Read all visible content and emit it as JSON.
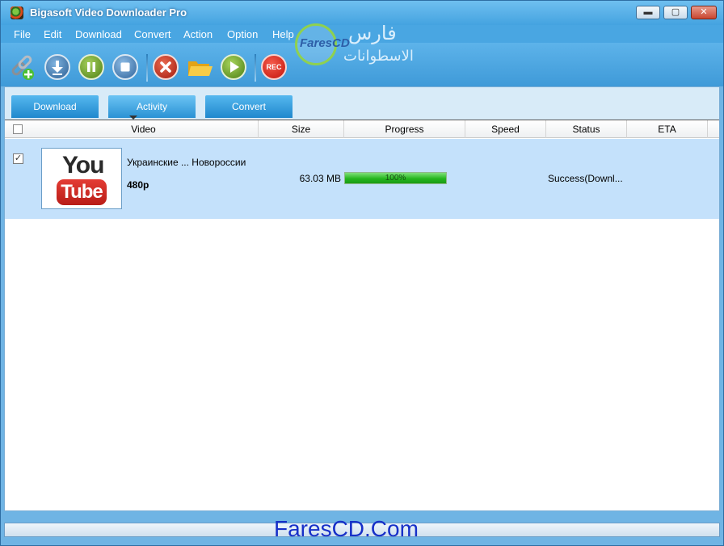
{
  "window": {
    "title": "Bigasoft Video Downloader Pro"
  },
  "window_controls": {
    "minimize": "▬",
    "maximize": "▢",
    "close": "✕"
  },
  "menu": [
    "File",
    "Edit",
    "Download",
    "Convert",
    "Action",
    "Option",
    "Help"
  ],
  "toolbar": {
    "rec_label": "REC",
    "icons": [
      "add-url-icon",
      "download-icon",
      "pause-icon",
      "stop-icon",
      "delete-icon",
      "open-folder-icon",
      "play-icon",
      "record-icon"
    ]
  },
  "logo": {
    "latin": "FaresCD",
    "arabic_top": "فارس",
    "arabic_bottom": "الاسطوانات"
  },
  "tabs": [
    {
      "label": "Download"
    },
    {
      "label": "Activity",
      "active": true
    },
    {
      "label": "Convert"
    }
  ],
  "columns": [
    "Video",
    "Size",
    "Progress",
    "Speed",
    "Status",
    "ETA"
  ],
  "rows": [
    {
      "checked": true,
      "checkmark": "✓",
      "thumbnail": {
        "you": "You",
        "tube": "Tube"
      },
      "title": "Украинские ... Новороссии",
      "quality": "480p",
      "size": "63.03 MB",
      "progress_text": "100%",
      "progress_fraction": 1.0,
      "speed": "",
      "status": "Success(Downl...",
      "eta": ""
    }
  ],
  "watermark": "FaresCD.Com",
  "colors": {
    "titlebar": "#44a3e0",
    "row_selected": "#c4e1fb",
    "progress_green": "#25b61f",
    "watermark": "#1730c8"
  }
}
